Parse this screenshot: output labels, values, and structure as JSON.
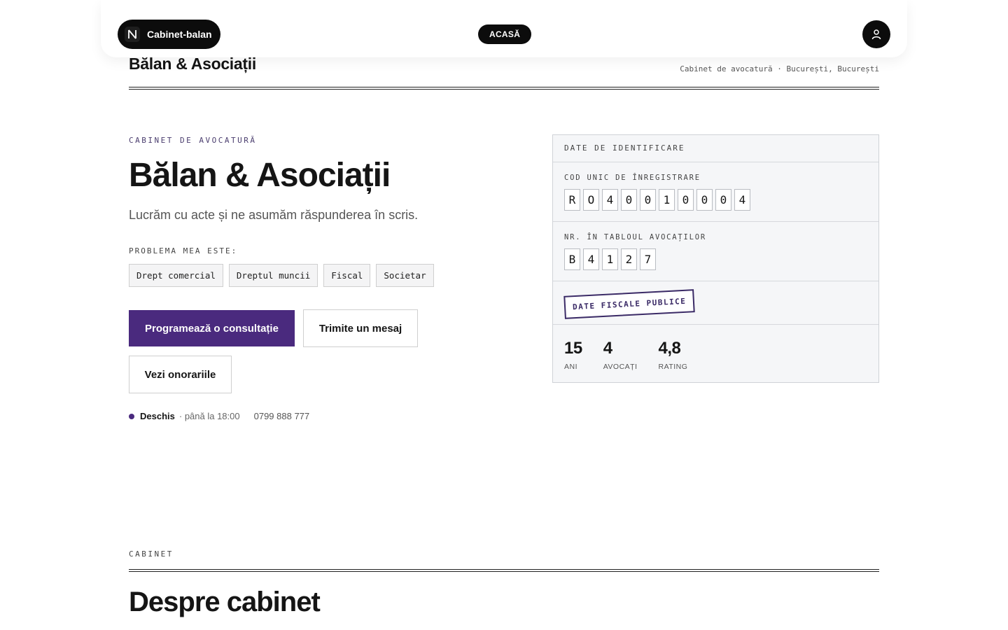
{
  "nav": {
    "brand": "Cabinet-balan",
    "home_label": "ACASĂ"
  },
  "header": {
    "site_name": "Bălan & Asociații",
    "meta": "Cabinet de avocatură · București, București"
  },
  "hero": {
    "eyebrow": "CABINET DE AVOCATURĂ",
    "title": "Bălan & Asociații",
    "subtitle": "Lucrăm cu acte și ne asumăm răspunderea în scris.",
    "problem_label": "PROBLEMA MEA ESTE:",
    "chips": [
      "Drept comercial",
      "Dreptul muncii",
      "Fiscal",
      "Societar"
    ],
    "primary_cta": "Programează o consultație",
    "message_cta": "Trimite un mesaj",
    "fees_cta": "Vezi onorariile",
    "status_open": "Deschis",
    "status_until": "· până la 18:00",
    "phone": "0799 888 777"
  },
  "card": {
    "title": "DATE DE IDENTIFICARE",
    "cui_label": "COD UNIC DE ÎNREGISTRARE",
    "cui_digits": [
      "R",
      "O",
      "4",
      "0",
      "0",
      "1",
      "0",
      "0",
      "0",
      "4"
    ],
    "bar_label": "NR. ÎN TABLOUL AVOCAȚILOR",
    "bar_digits": [
      "B",
      "4",
      "1",
      "2",
      "7"
    ],
    "stamp": "DATE FISCALE PUBLICE",
    "stats": [
      {
        "value": "15",
        "label": "ANI"
      },
      {
        "value": "4",
        "label": "AVOCAȚI"
      },
      {
        "value": "4,8",
        "label": "RATING"
      }
    ]
  },
  "section": {
    "eyebrow": "CABINET",
    "title": "Despre cabinet"
  },
  "colors": {
    "accent": "#4a2a7e",
    "dark": "#0c0c0c",
    "card_bg": "#f5f6f8"
  }
}
